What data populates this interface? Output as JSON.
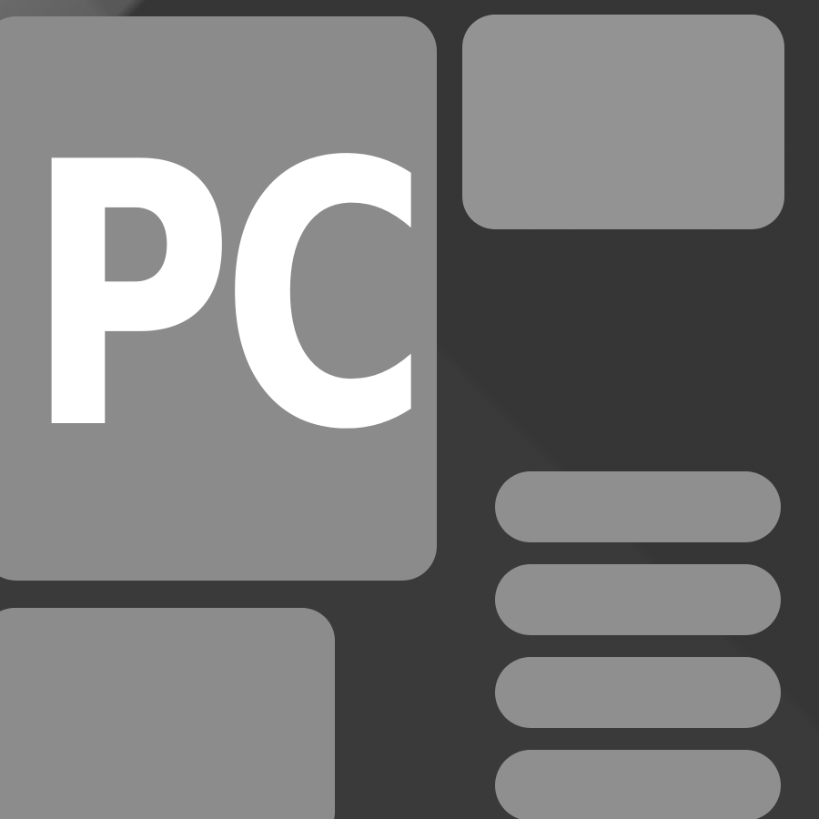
{
  "logo": {
    "text": "PC"
  },
  "colors": {
    "background": "#373737",
    "tile": "#8e8e8e",
    "logo_text": "#ffffff"
  },
  "layout_tiles": {
    "list_bars_count": 4
  }
}
